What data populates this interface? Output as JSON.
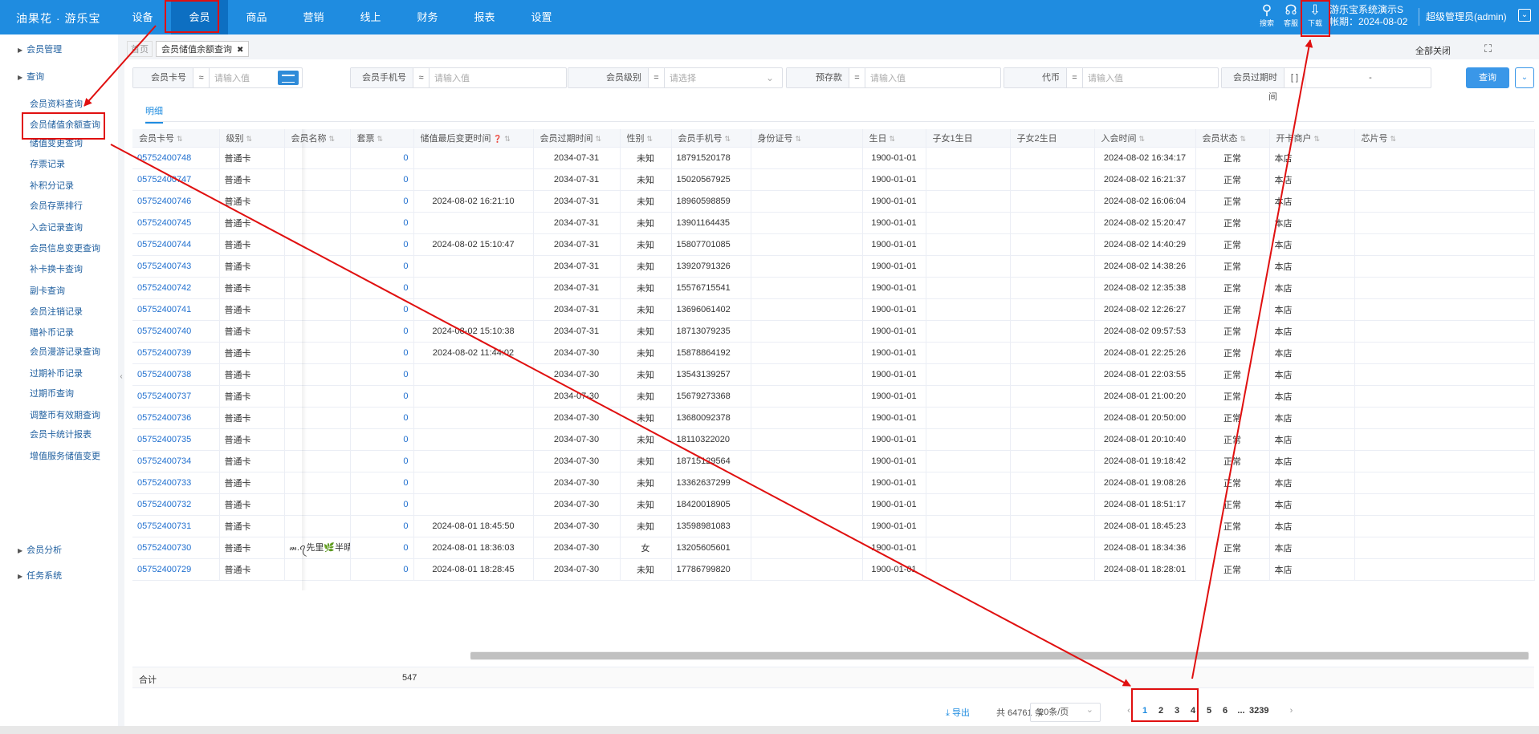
{
  "header": {
    "logo": "油果花 · 游乐宝",
    "nav": [
      "设备",
      "会员",
      "商品",
      "营销",
      "线上",
      "财务",
      "报表",
      "设置"
    ],
    "active_nav": "会员",
    "icons": [
      {
        "name": "search-icon",
        "label": "搜索"
      },
      {
        "name": "headset-icon",
        "label": "客服"
      },
      {
        "name": "download-icon",
        "label": "下载"
      }
    ],
    "shop_name": "游乐宝系统演示S",
    "account_date": "帐期：2024-08-02",
    "user": "超级管理员(admin)"
  },
  "sidebar": {
    "groups": [
      {
        "label": "会员管理"
      },
      {
        "label": "查询"
      },
      {
        "label": "会员分析"
      },
      {
        "label": "任务系统"
      }
    ],
    "items": [
      "会员资料查询",
      "会员储值余额查询",
      "储值变更查询",
      "存票记录",
      "补积分记录",
      "会员存票排行",
      "入会记录查询",
      "会员信息变更查询",
      "补卡换卡查询",
      "副卡查询",
      "会员注销记录",
      "赠补币记录",
      "会员漫游记录查询",
      "过期补币记录",
      "过期币查询",
      "调整币有效期查询",
      "会员卡统计报表",
      "增值服务储值变更"
    ],
    "active_item": "会员储值余额查询"
  },
  "tabs": {
    "home": "首页",
    "current": "会员储值余额查询",
    "close_all": "全部关闭"
  },
  "filters": [
    {
      "label": "会员卡号",
      "op": "≈",
      "placeholder": "请输入值"
    },
    {
      "label": "会员手机号",
      "op": "≈",
      "placeholder": "请输入值"
    },
    {
      "label": "会员级别",
      "op": "=",
      "placeholder": "请选择"
    },
    {
      "label": "预存款",
      "op": "=",
      "placeholder": "请输入值"
    },
    {
      "label": "代币",
      "op": "=",
      "placeholder": "请输入值"
    },
    {
      "label": "会员过期时间",
      "op": "[ ]",
      "placeholder": "-"
    }
  ],
  "query_button": "查询",
  "subtab": "明细",
  "table": {
    "columns": [
      "会员卡号",
      "级别",
      "会员名称",
      "套票",
      "储值最后变更时间",
      "会员过期时间",
      "性别",
      "会员手机号",
      "身份证号",
      "生日",
      "子女1生日",
      "子女2生日",
      "入会时间",
      "会员状态",
      "开卡商户",
      "芯片号"
    ],
    "rows": [
      [
        "05752400748",
        "普通卡",
        "",
        "0",
        "",
        "2034-07-31",
        "未知",
        "18791520178",
        "",
        "1900-01-01",
        "",
        "",
        "2024-08-02 16:34:17",
        "正常",
        "本店",
        ""
      ],
      [
        "05752400747",
        "普通卡",
        "",
        "0",
        "",
        "2034-07-31",
        "未知",
        "15020567925",
        "",
        "1900-01-01",
        "",
        "",
        "2024-08-02 16:21:37",
        "正常",
        "本店",
        ""
      ],
      [
        "05752400746",
        "普通卡",
        "",
        "0",
        "2024-08-02 16:21:10",
        "2034-07-31",
        "未知",
        "18960598859",
        "",
        "1900-01-01",
        "",
        "",
        "2024-08-02 16:06:04",
        "正常",
        "本店",
        ""
      ],
      [
        "05752400745",
        "普通卡",
        "",
        "0",
        "",
        "2034-07-31",
        "未知",
        "13901164435",
        "",
        "1900-01-01",
        "",
        "",
        "2024-08-02 15:20:47",
        "正常",
        "本店",
        ""
      ],
      [
        "05752400744",
        "普通卡",
        "",
        "0",
        "2024-08-02 15:10:47",
        "2034-07-31",
        "未知",
        "15807701085",
        "",
        "1900-01-01",
        "",
        "",
        "2024-08-02 14:40:29",
        "正常",
        "本店",
        ""
      ],
      [
        "05752400743",
        "普通卡",
        "",
        "0",
        "",
        "2034-07-31",
        "未知",
        "13920791326",
        "",
        "1900-01-01",
        "",
        "",
        "2024-08-02 14:38:26",
        "正常",
        "本店",
        ""
      ],
      [
        "05752400742",
        "普通卡",
        "",
        "0",
        "",
        "2034-07-31",
        "未知",
        "15576715541",
        "",
        "1900-01-01",
        "",
        "",
        "2024-08-02 12:35:38",
        "正常",
        "本店",
        ""
      ],
      [
        "05752400741",
        "普通卡",
        "",
        "0",
        "",
        "2034-07-31",
        "未知",
        "13696061402",
        "",
        "1900-01-01",
        "",
        "",
        "2024-08-02 12:26:27",
        "正常",
        "本店",
        ""
      ],
      [
        "05752400740",
        "普通卡",
        "",
        "0",
        "2024-08-02 15:10:38",
        "2034-07-31",
        "未知",
        "18713079235",
        "",
        "1900-01-01",
        "",
        "",
        "2024-08-02 09:57:53",
        "正常",
        "本店",
        ""
      ],
      [
        "05752400739",
        "普通卡",
        "",
        "0",
        "2024-08-02 11:44:02",
        "2034-07-30",
        "未知",
        "15878864192",
        "",
        "1900-01-01",
        "",
        "",
        "2024-08-01 22:25:26",
        "正常",
        "本店",
        ""
      ],
      [
        "05752400738",
        "普通卡",
        "",
        "0",
        "",
        "2034-07-30",
        "未知",
        "13543139257",
        "",
        "1900-01-01",
        "",
        "",
        "2024-08-01 22:03:55",
        "正常",
        "本店",
        ""
      ],
      [
        "05752400737",
        "普通卡",
        "",
        "0",
        "",
        "2034-07-30",
        "未知",
        "15679273368",
        "",
        "1900-01-01",
        "",
        "",
        "2024-08-01 21:00:20",
        "正常",
        "本店",
        ""
      ],
      [
        "05752400736",
        "普通卡",
        "",
        "0",
        "",
        "2034-07-30",
        "未知",
        "13680092378",
        "",
        "1900-01-01",
        "",
        "",
        "2024-08-01 20:50:00",
        "正常",
        "本店",
        ""
      ],
      [
        "05752400735",
        "普通卡",
        "",
        "0",
        "",
        "2034-07-30",
        "未知",
        "18110322020",
        "",
        "1900-01-01",
        "",
        "",
        "2024-08-01 20:10:40",
        "正常",
        "本店",
        ""
      ],
      [
        "05752400734",
        "普通卡",
        "",
        "0",
        "",
        "2034-07-30",
        "未知",
        "18715129564",
        "",
        "1900-01-01",
        "",
        "",
        "2024-08-01 19:18:42",
        "正常",
        "本店",
        ""
      ],
      [
        "05752400733",
        "普通卡",
        "",
        "0",
        "",
        "2034-07-30",
        "未知",
        "13362637299",
        "",
        "1900-01-01",
        "",
        "",
        "2024-08-01 19:08:26",
        "正常",
        "本店",
        ""
      ],
      [
        "05752400732",
        "普通卡",
        "",
        "0",
        "",
        "2034-07-30",
        "未知",
        "18420018905",
        "",
        "1900-01-01",
        "",
        "",
        "2024-08-01 18:51:17",
        "正常",
        "本店",
        ""
      ],
      [
        "05752400731",
        "普通卡",
        "",
        "0",
        "2024-08-01 18:45:50",
        "2034-07-30",
        "未知",
        "13598981083",
        "",
        "1900-01-01",
        "",
        "",
        "2024-08-01 18:45:23",
        "正常",
        "本店",
        ""
      ],
      [
        "05752400730",
        "普通卡",
        "𝓂.ꪖ先里🌿半晴",
        "0",
        "2024-08-01 18:36:03",
        "2034-07-30",
        "女",
        "13205605601",
        "",
        "1900-01-01",
        "",
        "",
        "2024-08-01 18:34:36",
        "正常",
        "本店",
        ""
      ],
      [
        "05752400729",
        "普通卡",
        "",
        "0",
        "2024-08-01 18:28:45",
        "2034-07-30",
        "未知",
        "17786799820",
        "",
        "1900-01-01",
        "",
        "",
        "2024-08-01 18:28:01",
        "正常",
        "本店",
        ""
      ]
    ]
  },
  "summary": {
    "label": "合计",
    "value": "547"
  },
  "pager": {
    "export": "导出",
    "total": "共 64761 条",
    "page_size": "20条/页",
    "pages": [
      "1",
      "2",
      "3",
      "4",
      "5",
      "6",
      "...",
      "3239"
    ],
    "current": "1"
  },
  "colors": {
    "primary": "#1f8ce0",
    "annotation": "#e01010"
  }
}
